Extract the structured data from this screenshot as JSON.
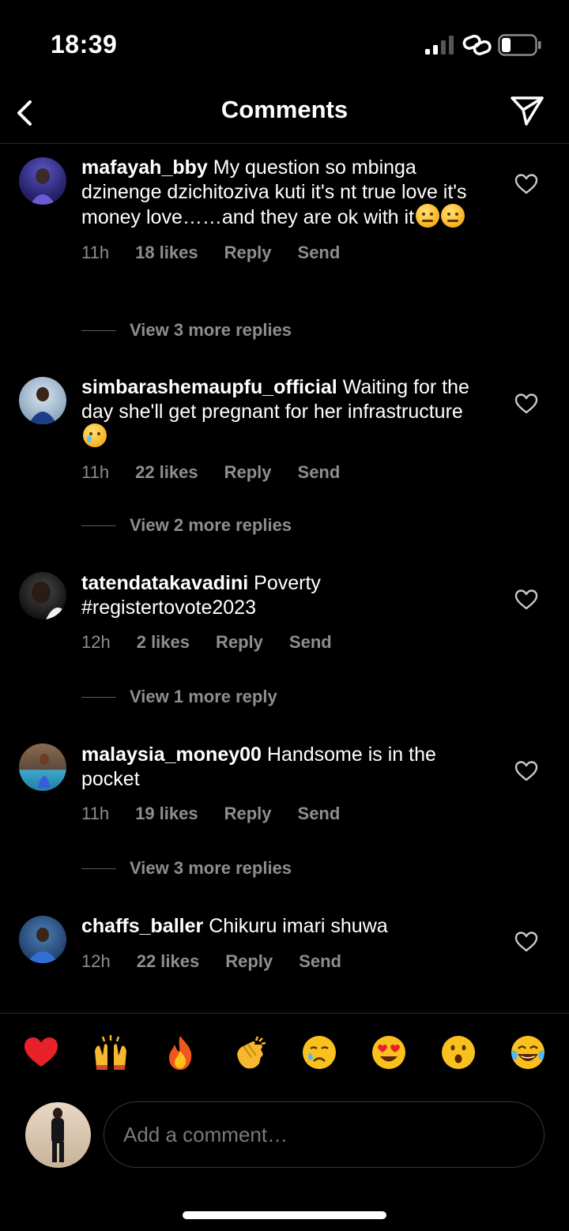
{
  "status_bar": {
    "time": "18:39"
  },
  "header": {
    "title": "Comments"
  },
  "comments": [
    {
      "username": "mafayah_bby",
      "text": "My question so mbinga dzinenge dzichitoziva kuti it's nt true love it's money love……and they are ok with it",
      "emojis": [
        "face-with-raised-eyebrow",
        "face-with-raised-eyebrow"
      ],
      "time": "11h",
      "likes": "18 likes",
      "reply": "Reply",
      "send": "Send",
      "view_replies": "View 3 more replies"
    },
    {
      "username": "simbarashemaupfu_official",
      "text": "Waiting for the day she'll get pregnant for her infrastructure",
      "emojis": [
        "crying-face"
      ],
      "time": "11h",
      "likes": "22 likes",
      "reply": "Reply",
      "send": "Send",
      "view_replies": "View 2 more replies"
    },
    {
      "username": "tatendatakavadini",
      "text": "Poverty #registertovote2023",
      "emojis": [],
      "time": "12h",
      "likes": "2 likes",
      "reply": "Reply",
      "send": "Send",
      "view_replies": "View 1 more reply"
    },
    {
      "username": "malaysia_money00",
      "text": "Handsome is in the pocket",
      "emojis": [],
      "time": "11h",
      "likes": "19 likes",
      "reply": "Reply",
      "send": "Send",
      "view_replies": "View 3 more replies"
    },
    {
      "username": "chaffs_baller",
      "text": "Chikuru imari shuwa",
      "emojis": [],
      "time": "12h",
      "likes": "22 likes",
      "reply": "Reply",
      "send": "Send"
    }
  ],
  "quick_reactions": [
    "red-heart",
    "raising-hands",
    "fire",
    "clapping-hands",
    "crying-face",
    "heart-eyes-face",
    "astonished-face",
    "tears-of-joy-face"
  ],
  "composer": {
    "placeholder": "Add a comment…"
  },
  "colors": {
    "background": "#000000",
    "text": "#ffffff",
    "muted": "#8e8e8e"
  }
}
